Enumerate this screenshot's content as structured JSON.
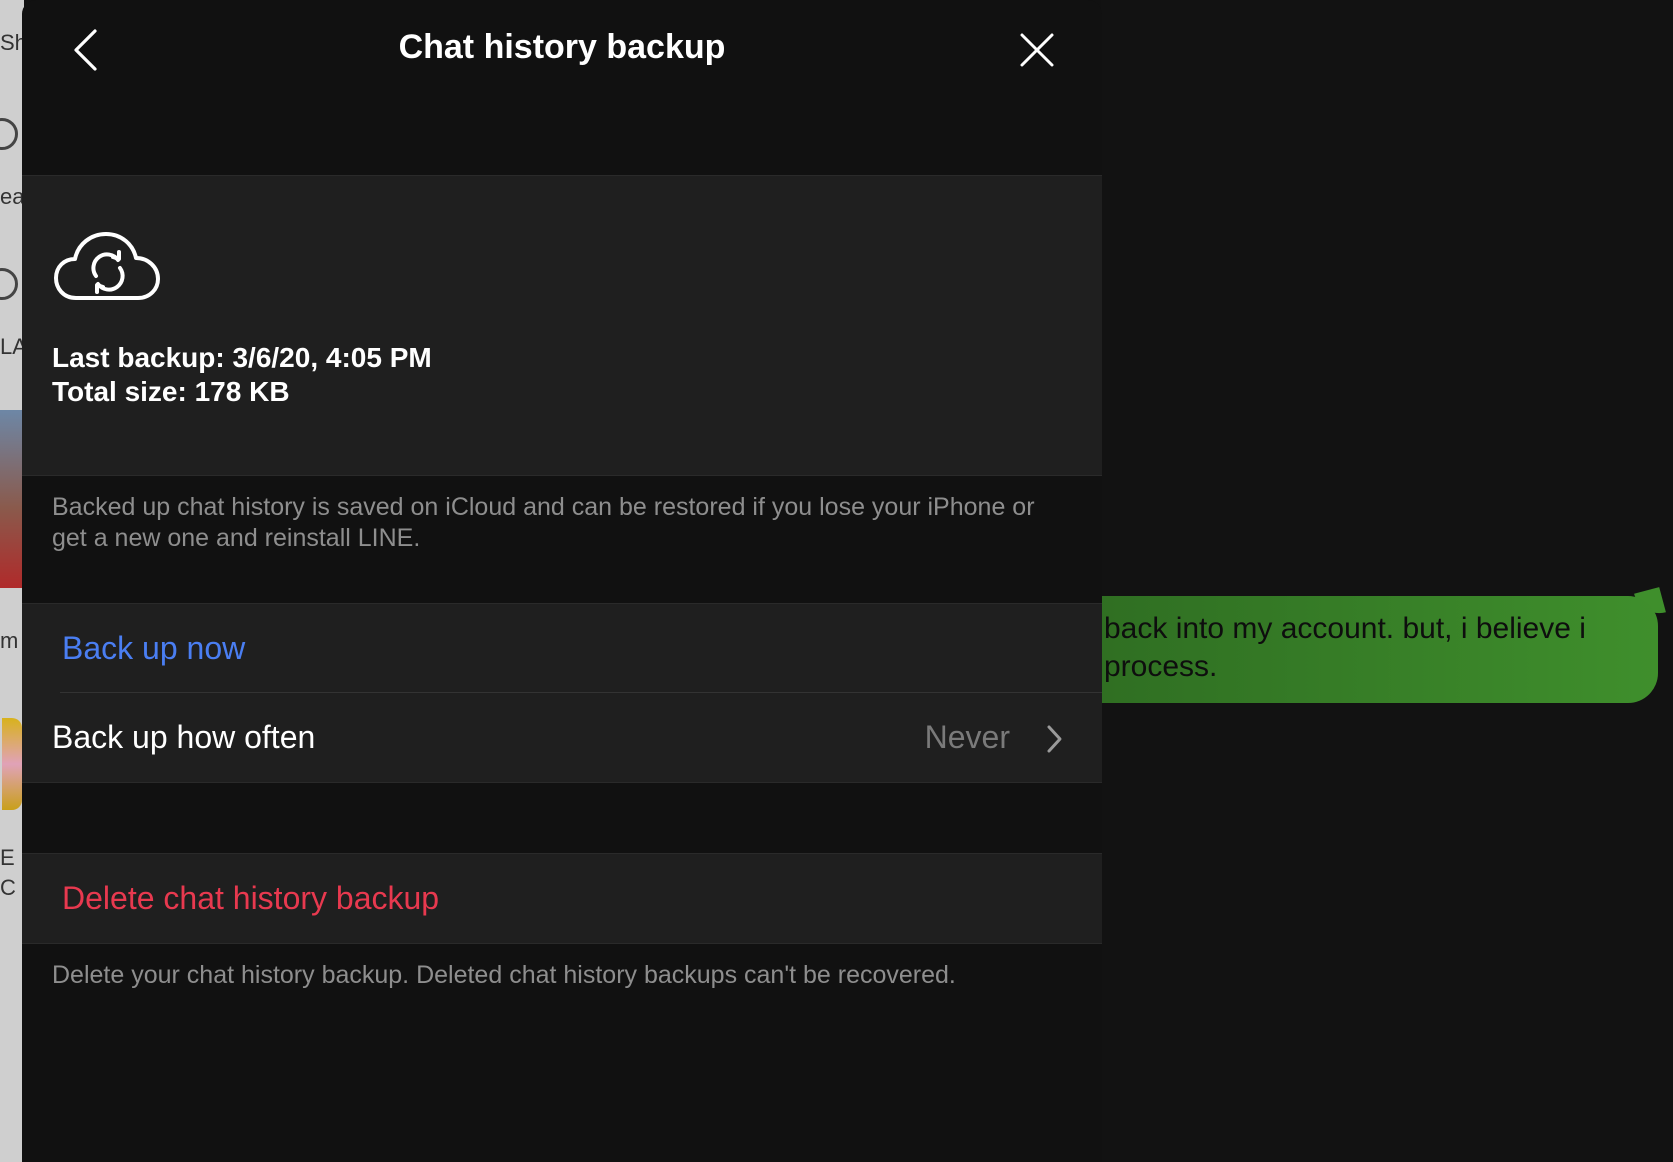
{
  "background": {
    "left_fragments": [
      "Sh",
      "ea",
      "LA",
      "m",
      "E",
      "C"
    ],
    "bubble_lines": [
      "back into my account.  but, i believe i",
      "process."
    ],
    "bubble_color": "#3f8f2c"
  },
  "panel": {
    "title": "Chat history backup",
    "back_icon": "chevron-left-icon",
    "close_icon": "close-icon"
  },
  "info": {
    "icon": "cloud-sync-icon",
    "last_backup": "Last backup: 3/6/20, 4:05 PM",
    "total_size": "Total size: 178 KB"
  },
  "description": "Backed up chat history is saved on iCloud and can be restored if you lose your iPhone or get a new one and reinstall LINE.",
  "actions": {
    "backup_now": "Back up now",
    "backup_often_label": "Back up how often",
    "backup_often_value": "Never",
    "delete_backup": "Delete chat history backup"
  },
  "delete_description": "Delete your chat history backup. Deleted chat history backups can't be recovered.",
  "colors": {
    "link_blue": "#4a7ef2",
    "danger_red": "#e8394f",
    "panel_bg": "#111111",
    "card_bg": "#1f1f1f"
  }
}
